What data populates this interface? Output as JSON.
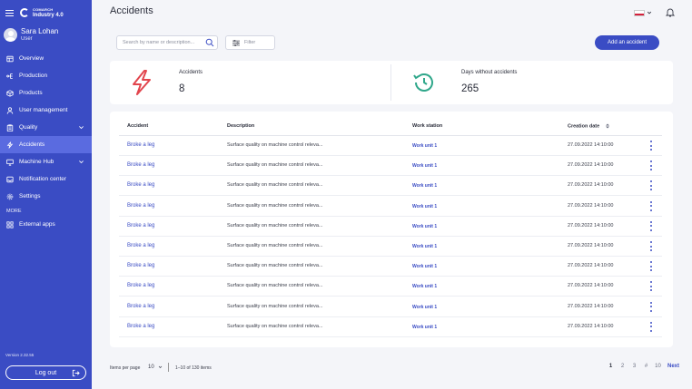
{
  "app": {
    "logo_line1": "COMARCH",
    "logo_line2": "Industry 4.0",
    "version": "Version 2.32.55"
  },
  "user": {
    "name": "Sara Lohan",
    "role": "User"
  },
  "sidebar": {
    "items": [
      {
        "label": "Overview",
        "icon": "overview-icon"
      },
      {
        "label": "Production",
        "icon": "production-icon"
      },
      {
        "label": "Products",
        "icon": "box-icon"
      },
      {
        "label": "User management",
        "icon": "user-icon"
      },
      {
        "label": "Quality",
        "icon": "clipboard-icon",
        "expandable": true
      },
      {
        "label": "Accidents",
        "icon": "accident-icon",
        "active": true
      },
      {
        "label": "Machine Hub",
        "icon": "monitor-icon",
        "expandable": true
      },
      {
        "label": "Notification center",
        "icon": "notification-icon"
      },
      {
        "label": "Settings",
        "icon": "gear-icon"
      }
    ],
    "more_label": "MORE",
    "more_items": [
      {
        "label": "External apps",
        "icon": "apps-grid-icon"
      }
    ],
    "logout_label": "Log out"
  },
  "header": {
    "title": "Accidents",
    "language": "pl"
  },
  "toolbar": {
    "search_placeholder": "Search by name or description...",
    "filter_label": "Filter",
    "add_label": "Add an accident"
  },
  "stats": {
    "accidents_label": "Accidents",
    "accidents_value": "8",
    "days_label": "Days without accidents",
    "days_value": "265"
  },
  "table": {
    "headers": {
      "accident": "Accident",
      "description": "Description",
      "work_station": "Work station",
      "creation_date": "Creation date"
    },
    "rows": [
      {
        "accident": "Broke a leg",
        "description": "Surface quality on machine control releva...",
        "work_station": "Work unit 1",
        "date": "27.09.2022 14:10:00"
      },
      {
        "accident": "Broke a leg",
        "description": "Surface quality on machine control releva...",
        "work_station": "Work unit 1",
        "date": "27.09.2022 14:10:00"
      },
      {
        "accident": "Broke a leg",
        "description": "Surface quality on machine control releva...",
        "work_station": "Work unit 1",
        "date": "27.09.2022 14:10:00"
      },
      {
        "accident": "Broke a leg",
        "description": "Surface quality on machine control releva...",
        "work_station": "Work unit 1",
        "date": "27.09.2022 14:10:00"
      },
      {
        "accident": "Broke a leg",
        "description": "Surface quality on machine control releva...",
        "work_station": "Work unit 1",
        "date": "27.09.2022 14:10:00"
      },
      {
        "accident": "Broke a leg",
        "description": "Surface quality on machine control releva...",
        "work_station": "Work unit 1",
        "date": "27.09.2022 14:10:00"
      },
      {
        "accident": "Broke a leg",
        "description": "Surface quality on machine control releva...",
        "work_station": "Work unit 1",
        "date": "27.09.2022 14:10:00"
      },
      {
        "accident": "Broke a leg",
        "description": "Surface quality on machine control releva...",
        "work_station": "Work unit 1",
        "date": "27.09.2022 14:10:00"
      },
      {
        "accident": "Broke a leg",
        "description": "Surface quality on machine control releva...",
        "work_station": "Work unit 1",
        "date": "27.09.2022 14:10:00"
      },
      {
        "accident": "Broke a leg",
        "description": "Surface quality on machine control releva...",
        "work_station": "Work unit 1",
        "date": "27.09.2022 14:10:00"
      }
    ]
  },
  "pagination": {
    "items_per_page_label": "Items per page",
    "items_per_page_value": "10",
    "range": "1–10 of 130 items",
    "pages": [
      "1",
      "2",
      "3",
      "#",
      "10"
    ],
    "current": "1",
    "next_label": "Next"
  },
  "colors": {
    "primary": "#3a4cc4",
    "accent_red": "#e2454d",
    "accent_green": "#2fa78a"
  }
}
